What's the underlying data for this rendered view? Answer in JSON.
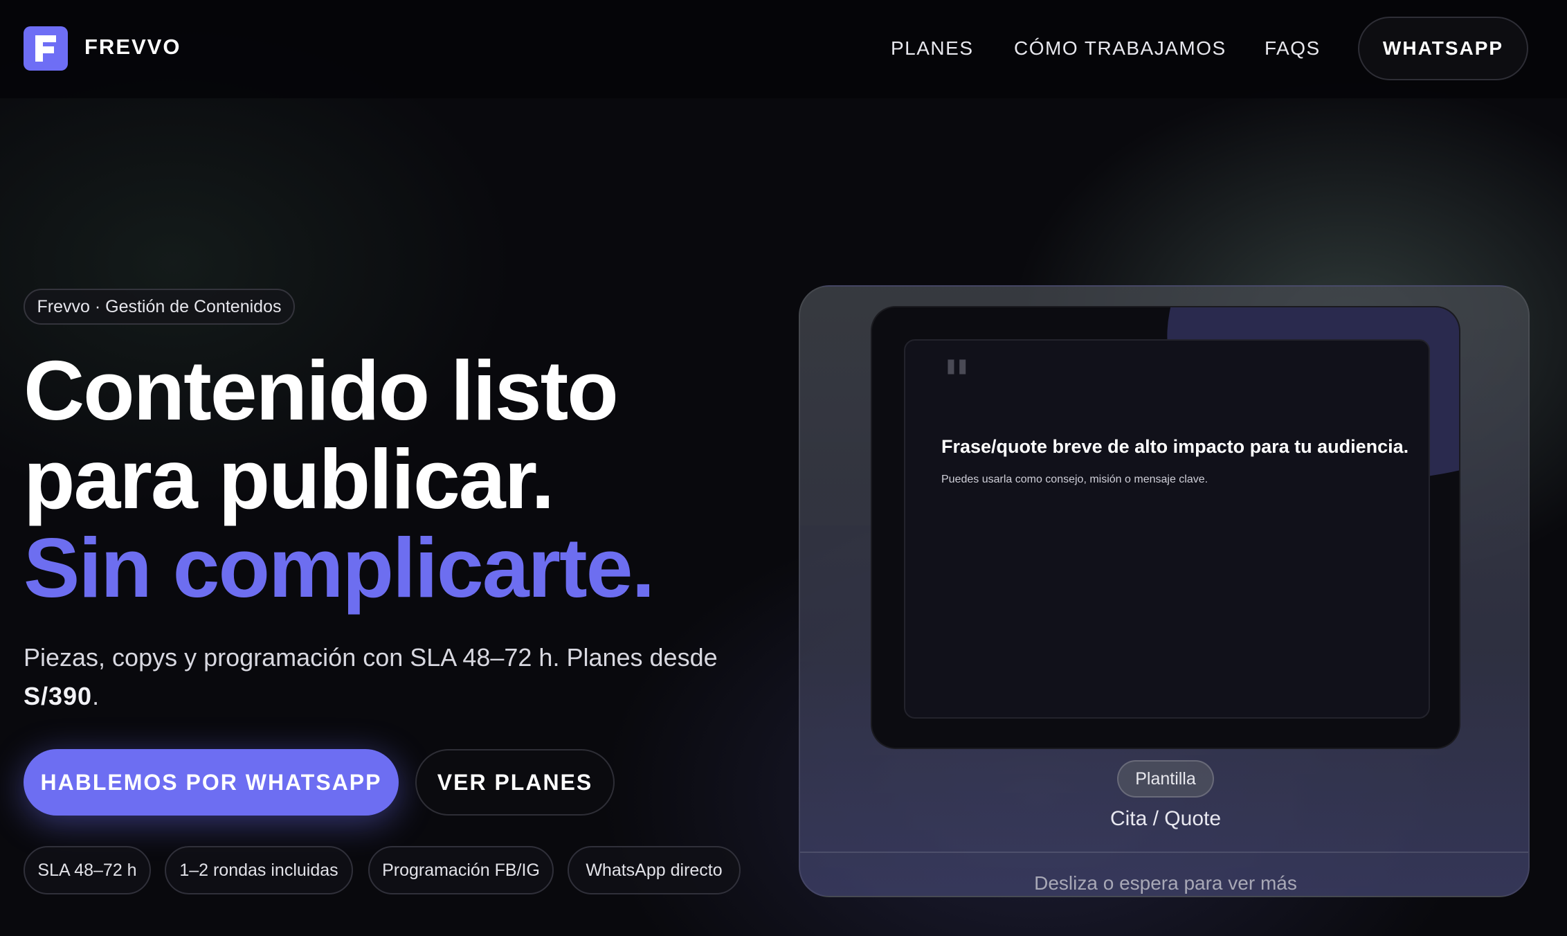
{
  "header": {
    "brand": "FREVVO",
    "logo_letter": "F",
    "nav": [
      "PLANES",
      "CÓMO TRABAJAMOS",
      "FAQS"
    ],
    "cta": "WHATSAPP"
  },
  "hero": {
    "eyebrow": "Frevvo · Gestión de Contenidos",
    "headline_line1": "Contenido listo",
    "headline_line2": "para publicar.",
    "headline_accent": "Sin complicarte.",
    "subtitle_text": "Piezas, copys y programación con SLA 48–72 h. Planes desde",
    "subtitle_price": "S/390",
    "subtitle_end": ".",
    "primary_button": "HABLEMOS POR WHATSAPP",
    "secondary_button": "VER PLANES",
    "chips": [
      "SLA 48–72 h",
      "1–2 rondas incluidas",
      "Programación FB/IG",
      "WhatsApp directo"
    ]
  },
  "showcase": {
    "quote_mark": "\"",
    "quote_text": "Frase/quote breve de alto impacto para tu audiencia.",
    "quote_note": "Puedes usarla como consejo, misión o mensaje clave.",
    "tag": "Plantilla",
    "caption": "Cita / Quote",
    "hint": "Desliza o espera para ver más"
  },
  "colors": {
    "accent": "#6d6ef2",
    "background": "#09090d"
  },
  "icons": {
    "logo": "frevvo-logo-icon",
    "quote": "quote-icon"
  }
}
